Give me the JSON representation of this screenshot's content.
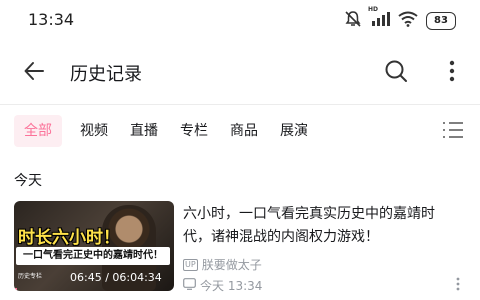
{
  "status_bar": {
    "time": "13:34",
    "battery": "83",
    "network": "HD"
  },
  "header": {
    "title": "历史记录"
  },
  "tabs": [
    {
      "label": "全部",
      "active": true
    },
    {
      "label": "视频",
      "active": false
    },
    {
      "label": "直播",
      "active": false
    },
    {
      "label": "专栏",
      "active": false
    },
    {
      "label": "商品",
      "active": false
    },
    {
      "label": "展演",
      "active": false
    }
  ],
  "section": {
    "title": "今天"
  },
  "item": {
    "title": "六小时，一口气看完真实历史中的嘉靖时代，诸神混战的内阁权力游戏！",
    "author": "朕要做太子",
    "time": "今天 13:34",
    "thumb_title": "时长六小时！",
    "thumb_subtitle": "一口气看完正史中的嘉靖时代！",
    "thumb_tag": "历史专栏",
    "progress_text": "06:45 / 06:04:34",
    "progress_fraction": 0.019
  },
  "colors": {
    "accent": "#fb7299",
    "muted": "#9499a0"
  },
  "icons": [
    "mute-icon",
    "signal-icon",
    "wifi-icon",
    "battery-icon",
    "back-arrow-icon",
    "search-icon",
    "more-vertical-icon",
    "filter-list-icon",
    "up-badge-icon",
    "clock-icon"
  ]
}
